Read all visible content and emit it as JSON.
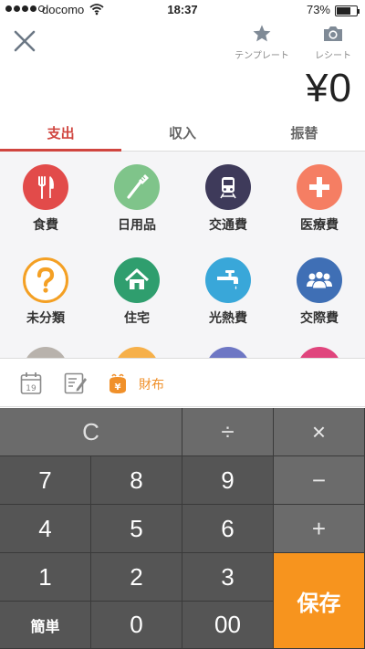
{
  "status_bar": {
    "carrier": "docomo",
    "time": "18:37",
    "battery_pct_text": "73%",
    "battery_level": 0.73
  },
  "header": {
    "template_label": "テンプレート",
    "receipt_label": "レシート",
    "amount": "¥0"
  },
  "tabs": [
    {
      "label": "支出",
      "active": true
    },
    {
      "label": "収入",
      "active": false
    },
    {
      "label": "振替",
      "active": false
    }
  ],
  "categories": [
    {
      "label": "食費",
      "icon": "fork-knife-icon",
      "color": "#e24b4a"
    },
    {
      "label": "日用品",
      "icon": "toothbrush-icon",
      "color": "#7fc48a"
    },
    {
      "label": "交通費",
      "icon": "train-icon",
      "color": "#3e3a5a"
    },
    {
      "label": "医療費",
      "icon": "medical-cross-icon",
      "color": "#f57e63"
    },
    {
      "label": "未分類",
      "icon": "question-icon",
      "color": "#f4a024"
    },
    {
      "label": "住宅",
      "icon": "house-icon",
      "color": "#2f9e6e"
    },
    {
      "label": "光熱費",
      "icon": "faucet-icon",
      "color": "#39a7d9"
    },
    {
      "label": "交際費",
      "icon": "people-icon",
      "color": "#3f6fb5"
    }
  ],
  "partial_colors": [
    "#b8b2ac",
    "#f6b04a",
    "#6e77c4",
    "#e0457d"
  ],
  "tools": {
    "calendar_day": "19",
    "wallet_label": "財布",
    "wallet_symbol": "¥"
  },
  "keypad": {
    "clear": "C",
    "divide": "÷",
    "multiply": "×",
    "minus": "−",
    "plus": "+",
    "save": "保存",
    "simple": "簡単",
    "digits": [
      "7",
      "8",
      "9",
      "4",
      "5",
      "6",
      "1",
      "2",
      "3",
      "0",
      "00"
    ]
  },
  "colors": {
    "accent": "#d0453f",
    "save": "#f7941e",
    "wallet": "#f0902a"
  }
}
